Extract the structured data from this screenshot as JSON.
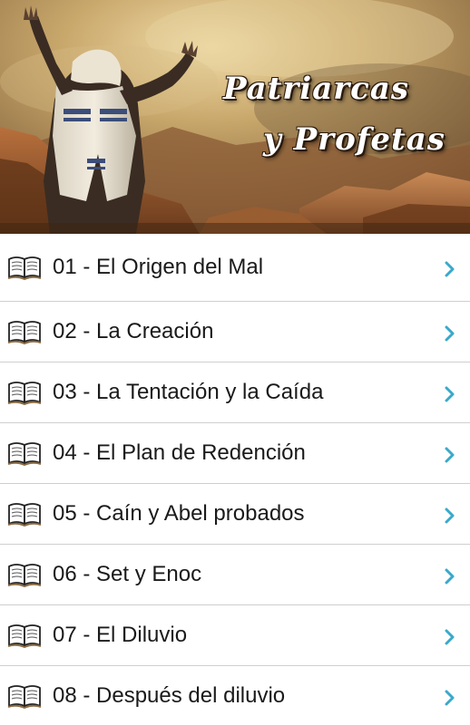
{
  "header": {
    "title_line1": "Patriarcas",
    "title_line2": "y Profetas"
  },
  "colors": {
    "accent_chevron": "#3ba9c9",
    "divider": "#cfcfcf",
    "text": "#1a1a1a"
  },
  "chapters": [
    {
      "label": "01 - El Origen del Mal",
      "icon": "open-book-icon"
    },
    {
      "label": "02 - La Creación",
      "icon": "open-book-icon"
    },
    {
      "label": "03 - La Tentación y la Caída",
      "icon": "open-book-icon"
    },
    {
      "label": "04 - El Plan de Redención",
      "icon": "open-book-icon"
    },
    {
      "label": "05 - Caín y Abel probados",
      "icon": "open-book-icon"
    },
    {
      "label": "06 - Set y Enoc",
      "icon": "open-book-icon"
    },
    {
      "label": "07 - El Diluvio",
      "icon": "open-book-icon"
    },
    {
      "label": "08 - Después del diluvio",
      "icon": "open-book-icon"
    }
  ]
}
